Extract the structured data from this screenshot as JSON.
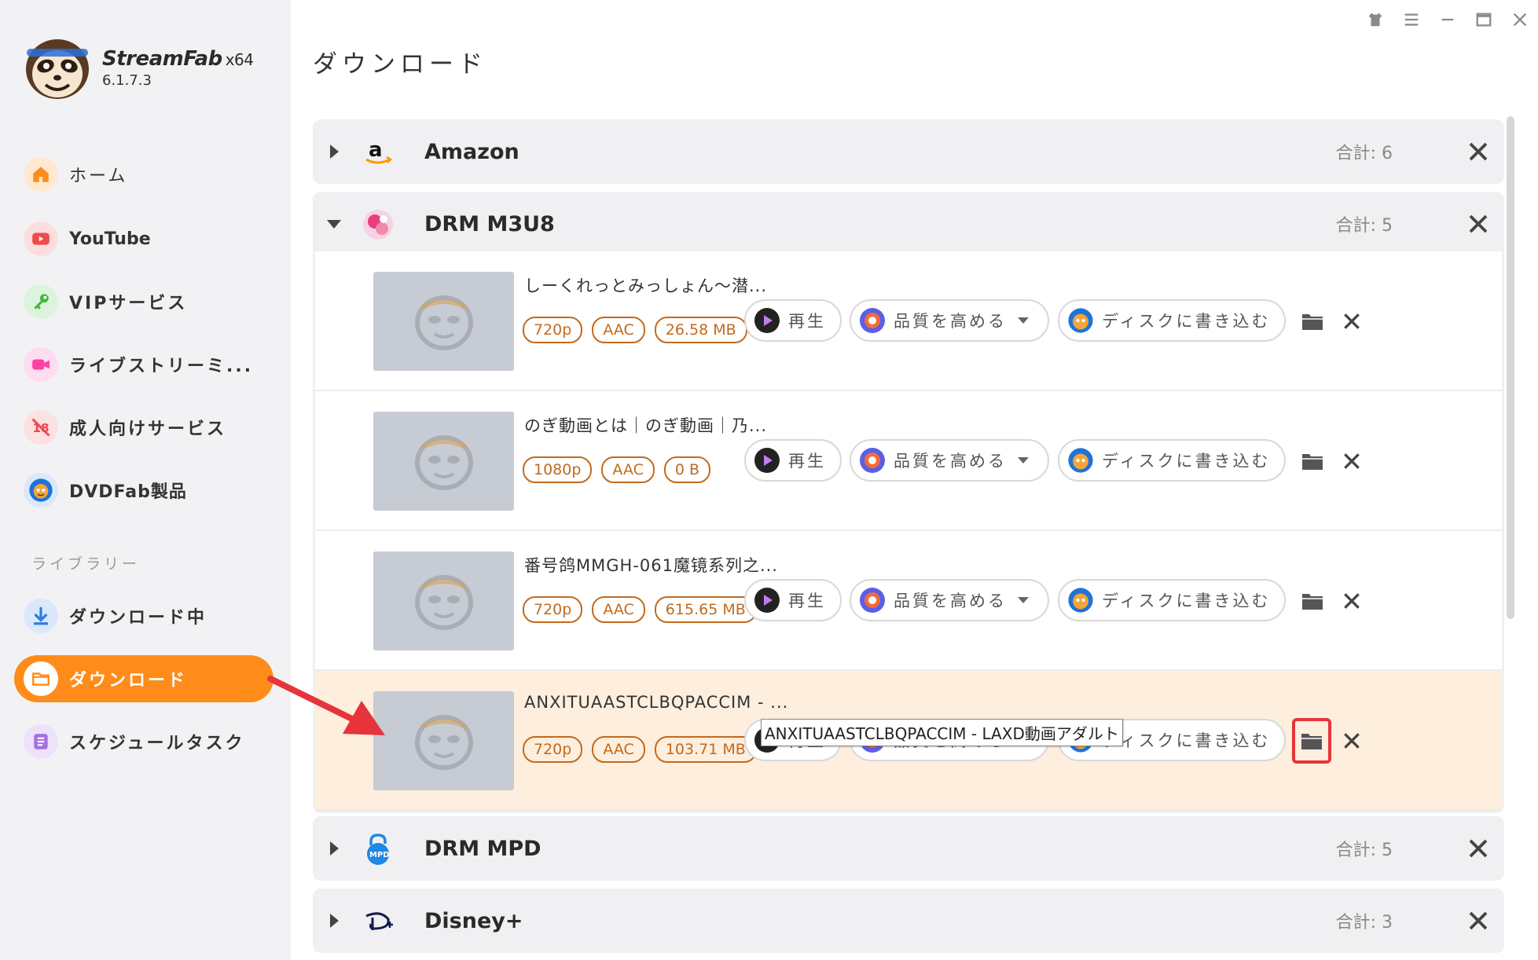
{
  "app": {
    "name": "StreamFab",
    "arch": "x64",
    "version": "6.1.7.3"
  },
  "sidebar": {
    "items": [
      {
        "label": "ホーム",
        "icon": "home-icon",
        "color": "#ff8c1a"
      },
      {
        "label": "YouTube",
        "icon": "youtube-icon",
        "color": "#f04a4a"
      },
      {
        "label": "VIPサービス",
        "icon": "key-icon",
        "color": "#3dbb3d"
      },
      {
        "label": "ライブストリーミ...",
        "icon": "camera-icon",
        "color": "#ff3fa6"
      },
      {
        "label": "成人向けサービス",
        "icon": "adult-block-icon",
        "color": "#f0464e"
      },
      {
        "label": "DVDFab製品",
        "icon": "dvdfab-icon",
        "color": "#1e73d8"
      }
    ],
    "section_label": "ライブラリー",
    "library": [
      {
        "label": "ダウンロード中",
        "icon": "download-arrow-icon",
        "color": "#2f7de1"
      },
      {
        "label": "ダウンロード",
        "icon": "folder-icon",
        "color": "#ff8c1a",
        "active": true
      },
      {
        "label": "スケジュールタスク",
        "icon": "schedule-list-icon",
        "color": "#a46ee0"
      }
    ]
  },
  "page": {
    "title": "ダウンロード"
  },
  "groups": [
    {
      "name": "Amazon",
      "total": "合計: 6",
      "expanded": false,
      "icon": "amazon-icon"
    },
    {
      "name": "DRM M3U8",
      "total": "合計: 5",
      "expanded": true,
      "icon": "drm-m3u8-icon"
    },
    {
      "name": "DRM MPD",
      "total": "合計: 5",
      "expanded": false,
      "icon": "mpd-lock-icon"
    },
    {
      "name": "Disney+",
      "total": "合計: 3",
      "expanded": false,
      "icon": "disney-plus-icon"
    }
  ],
  "items": [
    {
      "title": "しーくれっとみっしょん～潜...",
      "resolution": "720p",
      "audio": "AAC",
      "size": "26.58 MB"
    },
    {
      "title": "のぎ動画とは｜のぎ動画｜乃...",
      "resolution": "1080p",
      "audio": "AAC",
      "size": "0 B"
    },
    {
      "title": "番号鸽MMGH-061魔镜系列之...",
      "resolution": "720p",
      "audio": "AAC",
      "size": "615.65 MB"
    },
    {
      "title": "ANXITUAASTCLBQPACCIM - ...",
      "resolution": "720p",
      "audio": "AAC",
      "size": "103.71 MB"
    }
  ],
  "actions": {
    "play": "再生",
    "quality": "品質を高める",
    "disc": "ディスクに書き込む"
  },
  "tooltip": "ANXITUAASTCLBQPACCIM - LAXD動画アダルト",
  "colors": {
    "accent": "#ff8c1a",
    "tag": "#c26a1d",
    "highlight_row": "#fdeedd",
    "annotation": "#e6343a"
  }
}
